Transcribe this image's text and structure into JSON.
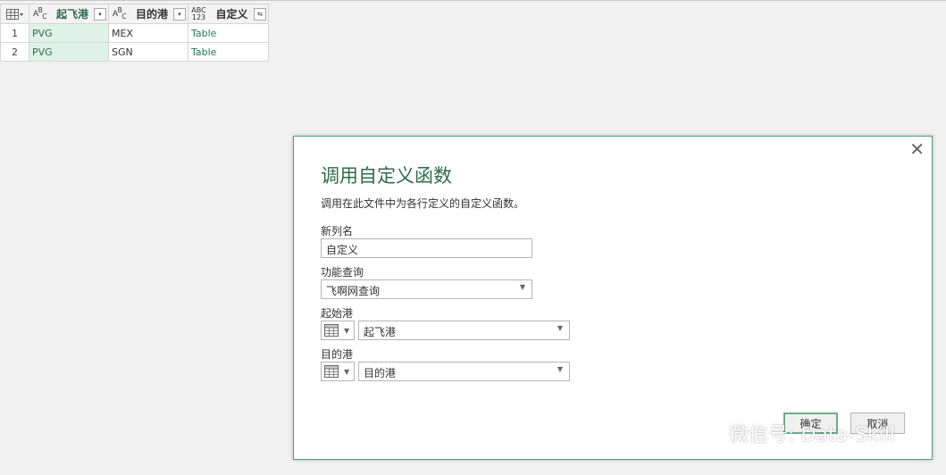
{
  "grid": {
    "columns": [
      {
        "type_icon": "ABC",
        "label": "起飞港",
        "filter": "▾"
      },
      {
        "type_icon": "ABC",
        "label": "目的港",
        "filter": "▾"
      },
      {
        "type_icon": "ABC123",
        "label": "自定义",
        "filter": "⇆"
      }
    ],
    "rows": [
      {
        "num": "1",
        "cells": [
          "PVG",
          "MEX",
          "Table"
        ]
      },
      {
        "num": "2",
        "cells": [
          "PVG",
          "SGN",
          "Table"
        ]
      }
    ]
  },
  "dialog": {
    "title": "调用自定义函数",
    "description": "调用在此文件中为各行定义的自定义函数。",
    "new_column_label": "新列名",
    "new_column_value": "自定义",
    "function_query_label": "功能查询",
    "function_query_value": "飞啊网查询",
    "param1_label": "起始港",
    "param1_value": "起飞港",
    "param2_label": "目的港",
    "param2_value": "目的港",
    "ok_label": "确定",
    "cancel_label": "取消",
    "close_glyph": "✕"
  },
  "watermark": {
    "text": "微信号: Data-Skill"
  },
  "colors": {
    "accent": "#2f6b4d",
    "dialog_border": "#4f9e7a",
    "selected_column": "#dff2e7"
  }
}
